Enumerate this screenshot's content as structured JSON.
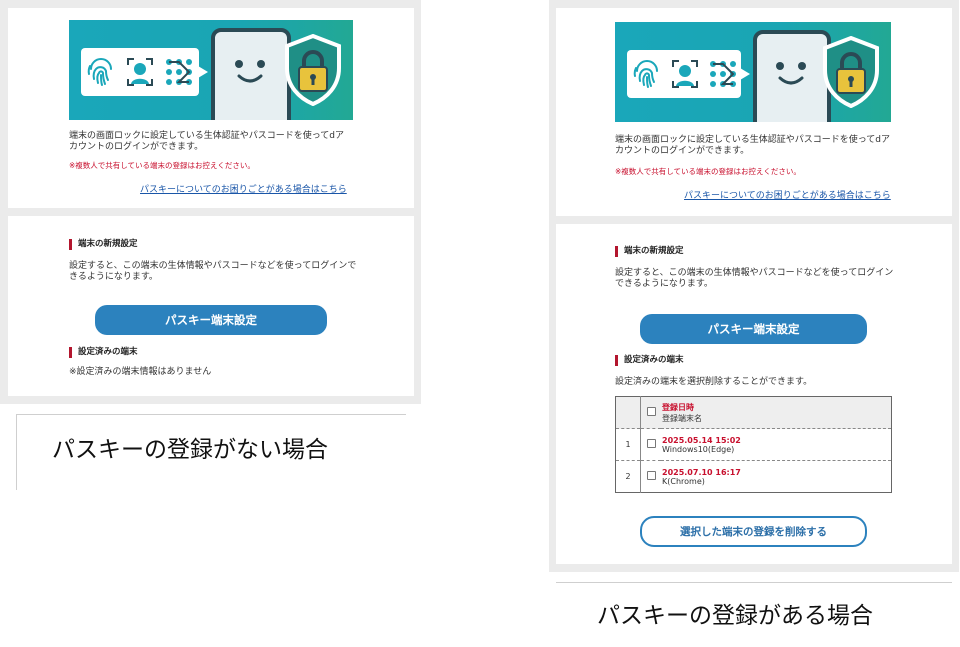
{
  "left": {
    "description": "端末の画面ロックに設定している生体認証やパスコードを使ってdアカウントのログインができます。",
    "warning": "※複数人で共有している端末の登録はお控えください。",
    "help_link": "パスキーについてのお困りごとがある場合はこちら",
    "new_heading": "端末の新規設定",
    "new_description": "設定すると、この端末の生体情報やパスコードなどを使ってログインできるようになります。",
    "register_button": "パスキー端末設定",
    "registered_heading": "設定済みの端末",
    "no_devices": "※設定済みの端末情報はありません",
    "caption": "パスキーの登録がない場合"
  },
  "right": {
    "description": "端末の画面ロックに設定している生体認証やパスコードを使ってdアカウントのログインができます。",
    "warning": "※複数人で共有している端末の登録はお控えください。",
    "help_link": "パスキーについてのお困りごとがある場合はこちら",
    "new_heading": "端末の新規設定",
    "new_description": "設定すると、この端末の生体情報やパスコードなどを使ってログインできるようになります。",
    "register_button": "パスキー端末設定",
    "registered_heading": "設定済みの端末",
    "registered_description": "設定済みの端末を選択削除することができます。",
    "table_header_date": "登録日時",
    "table_header_name": "登録端末名",
    "devices": [
      {
        "index": "1",
        "date": "2025.05.14 15:02",
        "name": "Windows10(Edge)"
      },
      {
        "index": "2",
        "date": "2025.07.10 16:17",
        "name": "K(Chrome)"
      }
    ],
    "delete_button": "選択した端末の登録を削除する",
    "caption": "パスキーの登録がある場合"
  },
  "colors": {
    "brand_red": "#c8102e",
    "button_blue": "#2c82be",
    "banner_teal": "#1aa7ba",
    "link_blue": "#1a56a8"
  },
  "icons": [
    "fingerprint-icon",
    "face-recognition-icon",
    "pattern-lock-icon",
    "shield-lock-icon",
    "smiley-phone-icon"
  ]
}
